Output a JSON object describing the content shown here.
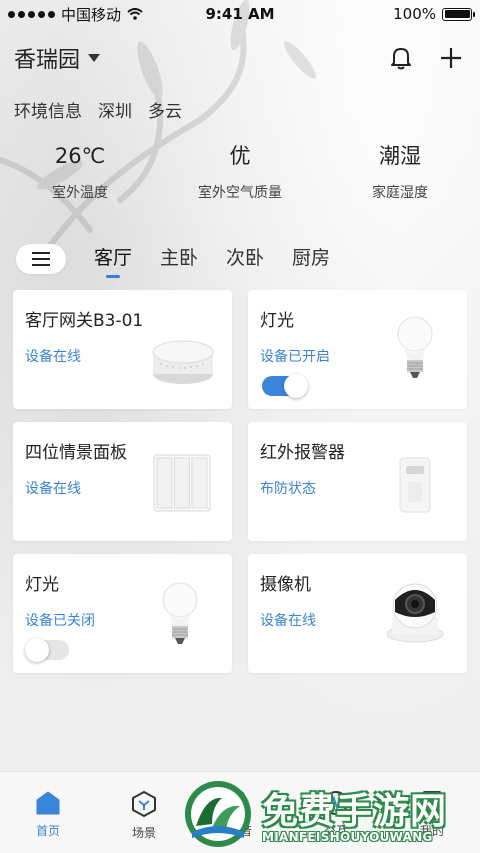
{
  "status_bar": {
    "carrier": "中国移动",
    "time": "9:41 AM",
    "battery": "100%",
    "battery_level": 1.0
  },
  "header": {
    "home_name": "香瑞园",
    "bell_icon": "bell-icon",
    "add_icon": "plus-icon"
  },
  "environment": {
    "label": "环境信息",
    "city": "深圳",
    "weather": "多云"
  },
  "stats": [
    {
      "value": "26℃",
      "label": "室外温度"
    },
    {
      "value": "优",
      "label": "室外空气质量"
    },
    {
      "value": "潮湿",
      "label": "家庭湿度"
    }
  ],
  "tabs": {
    "menu_icon": "hamburger-icon",
    "items": [
      {
        "label": "客厅",
        "active": true
      },
      {
        "label": "主卧",
        "active": false
      },
      {
        "label": "次卧",
        "active": false
      },
      {
        "label": "厨房",
        "active": false
      }
    ]
  },
  "devices": [
    {
      "title": "客厅网关B3-01",
      "state": "设备在线",
      "icon": "gateway-device"
    },
    {
      "title": "灯光",
      "state": "设备已开启",
      "icon": "light-bulb",
      "toggle": "on"
    },
    {
      "title": "四位情景面板",
      "state": "设备在线",
      "icon": "scene-panel"
    },
    {
      "title": "红外报警器",
      "state": "布防状态",
      "icon": "infrared-sensor"
    },
    {
      "title": "灯光",
      "state": "设备已关闭",
      "icon": "light-bulb",
      "toggle": "off"
    },
    {
      "title": "摄像机",
      "state": "设备在线",
      "icon": "camera"
    }
  ],
  "tabbar": [
    {
      "label": "首页",
      "icon": "home-icon",
      "active": true
    },
    {
      "label": "场景",
      "icon": "scene-icon",
      "active": false
    },
    {
      "label": "语音",
      "icon": "voice-icon",
      "active": false
    },
    {
      "label": "交互",
      "icon": "interact-icon",
      "active": false
    },
    {
      "label": "我的",
      "icon": "profile-icon",
      "active": false
    }
  ],
  "colors": {
    "accent": "#3a84d9",
    "watermark_green": "#2d8a4a"
  },
  "watermark": {
    "title": "免费手游网",
    "subtitle": "MIANFEISHOUYOUWANG"
  }
}
